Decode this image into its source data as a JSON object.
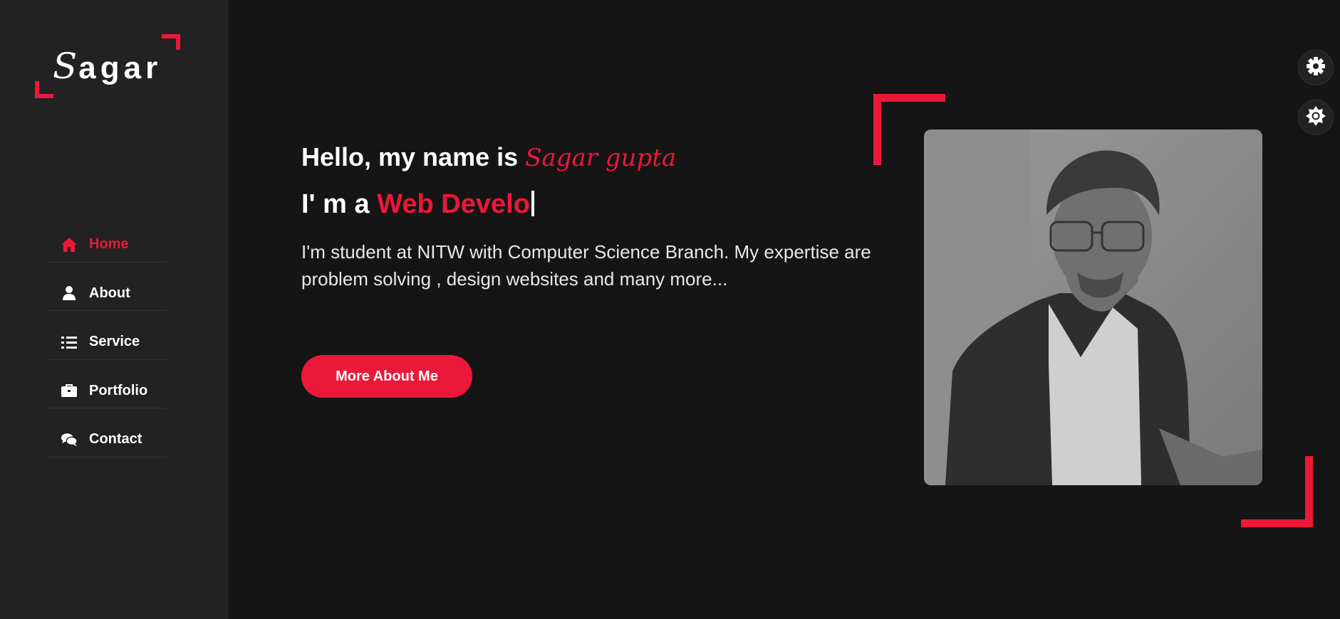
{
  "brand": {
    "logo_initial": "S",
    "logo_rest": "agar"
  },
  "nav": {
    "items": [
      {
        "label": "Home",
        "icon": "home-icon",
        "active": true
      },
      {
        "label": "About",
        "icon": "user-icon",
        "active": false
      },
      {
        "label": "Service",
        "icon": "list-icon",
        "active": false
      },
      {
        "label": "Portfolio",
        "icon": "briefcase-icon",
        "active": false
      },
      {
        "label": "Contact",
        "icon": "comments-icon",
        "active": false
      }
    ]
  },
  "hero": {
    "greeting": "Hello, my name is ",
    "name": "Sagar gupta",
    "role_prefix": "I' m a ",
    "role_typed": "Web Develo",
    "intro": "I'm student at NITW with Computer Science Branch. My expertise are problem solving , design websites and many more...",
    "cta_label": "More About Me"
  },
  "toolbar": {
    "settings_icon": "gear-icon",
    "theme_icon": "sun-icon"
  },
  "colors": {
    "accent": "#ec1839",
    "background": "#151515",
    "sidebar": "#222222",
    "text": "#ffffff"
  }
}
